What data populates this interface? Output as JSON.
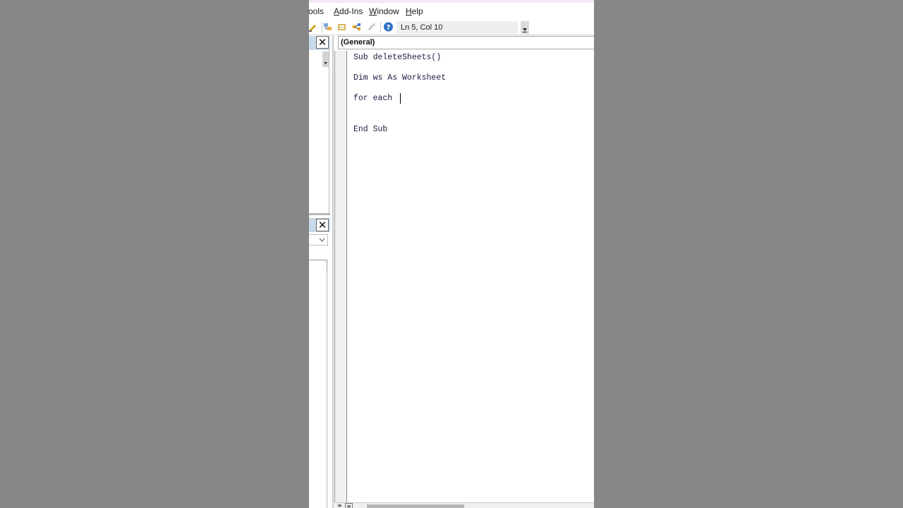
{
  "menu": {
    "items": [
      {
        "label": "Tools",
        "prefix": "",
        "accel": "T",
        "rest": "ools"
      },
      {
        "label": "Add-Ins",
        "prefix": "",
        "accel": "A",
        "rest": "dd-Ins"
      },
      {
        "label": "Window",
        "prefix": "",
        "accel": "W",
        "rest": "indow"
      },
      {
        "label": "Help",
        "prefix": "",
        "accel": "H",
        "rest": "elp"
      }
    ]
  },
  "toolbar": {
    "icons": [
      "design-mode-icon",
      "project-explorer-icon",
      "properties-window-icon",
      "object-browser-icon",
      "toolbox-icon",
      "help-icon"
    ],
    "status": "Ln 5, Col 10"
  },
  "code_window": {
    "object_selector": "(General)",
    "lines": [
      "Sub deleteSheets()",
      "Dim ws As Worksheet",
      "for each ",
      "End Sub"
    ]
  },
  "colors": {
    "background": "#878787",
    "code_text": "#1c1c44",
    "pane_header": "#c9daea"
  }
}
